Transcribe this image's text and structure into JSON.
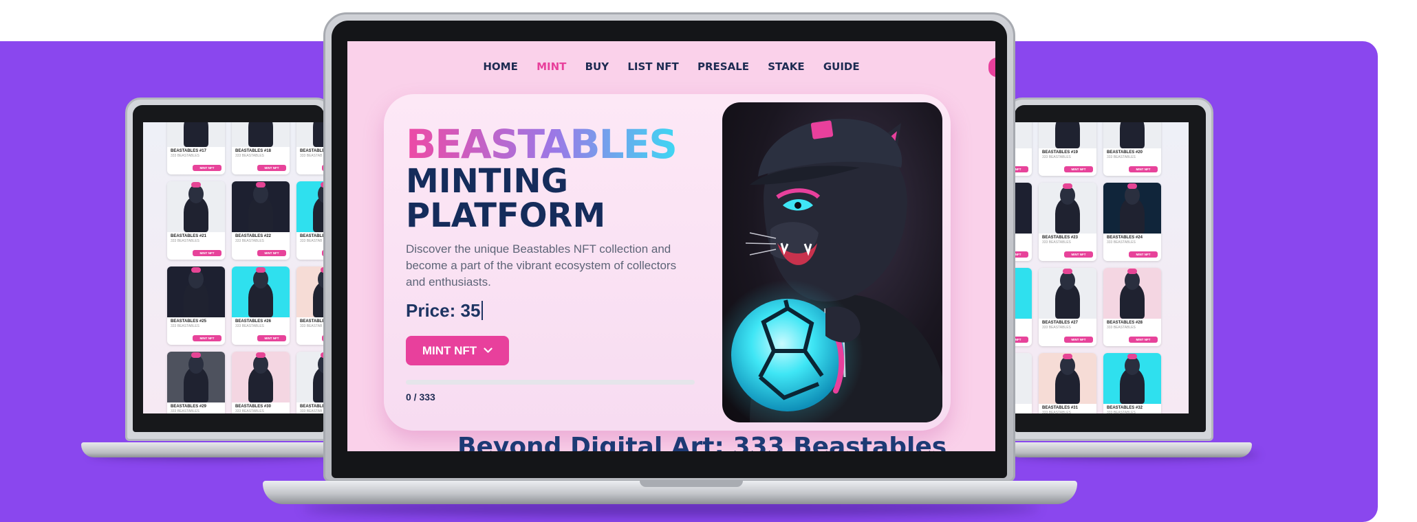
{
  "nav": {
    "items": [
      {
        "label": "HOME",
        "active": false
      },
      {
        "label": "MINT",
        "active": true
      },
      {
        "label": "BUY",
        "active": false
      },
      {
        "label": "LIST NFT",
        "active": false
      },
      {
        "label": "PRESALE",
        "active": false
      },
      {
        "label": "STAKE",
        "active": false
      },
      {
        "label": "GUIDE",
        "active": false
      }
    ]
  },
  "hero": {
    "brand": "BEASTABLES",
    "headline_line1": "MINTING",
    "headline_line2": "PLATFORM",
    "description": "Discover the unique Beastables NFT collection and become a part of the vibrant ecosystem of collectors and enthusiasts.",
    "price": "Price: 35",
    "mint_button": "MINT NFT",
    "mint_button_icon": "chevron-down-icon",
    "progress": {
      "minted": 0,
      "total": 333,
      "label": "0 / 333"
    }
  },
  "section_heading": "Beyond Digital Art: 333 Beastables",
  "colors": {
    "purple_background": "#8a47ee",
    "accent_pink": "#e8409c",
    "navy_text": "#152c5b",
    "screen_pink": "#fad1ea"
  },
  "left_laptop": {
    "cards": [
      {
        "title": "BEASTABLES #17",
        "sub": "333 BEASTABLES",
        "button": "MINT NFT",
        "tone": "t-white"
      },
      {
        "title": "BEASTABLES #18",
        "sub": "333 BEASTABLES",
        "button": "MINT NFT",
        "tone": "t-white"
      },
      {
        "title": "BEASTABLES",
        "sub": "333 BEASTAB",
        "button": "MINT NFT",
        "tone": "t-white"
      },
      {
        "title": "BEASTABLES #21",
        "sub": "333 BEASTABLES",
        "button": "MINT NFT",
        "tone": "t-white"
      },
      {
        "title": "BEASTABLES #22",
        "sub": "333 BEASTABLES",
        "button": "MINT NFT",
        "tone": "t-dark"
      },
      {
        "title": "BEASTABLES",
        "sub": "333 BEASTAB",
        "button": "MINT NFT",
        "tone": "t-cyan"
      },
      {
        "title": "BEASTABLES #25",
        "sub": "333 BEASTABLES",
        "button": "MINT NFT",
        "tone": "t-dark"
      },
      {
        "title": "BEASTABLES #26",
        "sub": "333 BEASTABLES",
        "button": "MINT NFT",
        "tone": "t-cyan"
      },
      {
        "title": "BEASTABLES",
        "sub": "333 BEASTAB",
        "button": "MINT NFT",
        "tone": "t-peach"
      },
      {
        "title": "BEASTABLES #29",
        "sub": "333 BEASTABLES",
        "button": "MINT NFT",
        "tone": "t-grey"
      },
      {
        "title": "BEASTABLES #30",
        "sub": "333 BEASTABLES",
        "button": "MINT NFT",
        "tone": "t-pink"
      },
      {
        "title": "BEASTABLES",
        "sub": "333 BEASTAB",
        "button": "MINT NFT",
        "tone": "t-white"
      }
    ]
  },
  "right_laptop": {
    "cards": [
      {
        "title": "S #18",
        "sub": "333 BEASTABLES",
        "button": "MINT NFT",
        "tone": "t-white"
      },
      {
        "title": "BEASTABLES #19",
        "sub": "333 BEASTABLES",
        "button": "MINT NFT",
        "tone": "t-white"
      },
      {
        "title": "BEASTABLES #20",
        "sub": "333 BEASTABLES",
        "button": "MINT NFT",
        "tone": "t-white"
      },
      {
        "title": "S #22",
        "sub": "333 BEASTABLES",
        "button": "MINT NFT",
        "tone": "t-dark"
      },
      {
        "title": "BEASTABLES #23",
        "sub": "333 BEASTABLES",
        "button": "MINT NFT",
        "tone": "t-white"
      },
      {
        "title": "BEASTABLES #24",
        "sub": "333 BEASTABLES",
        "button": "MINT NFT",
        "tone": "t-navy"
      },
      {
        "title": "S #26",
        "sub": "333 BEASTABLES",
        "button": "MINT NFT",
        "tone": "t-cyan"
      },
      {
        "title": "BEASTABLES #27",
        "sub": "333 BEASTABLES",
        "button": "MINT NFT",
        "tone": "t-white"
      },
      {
        "title": "BEASTABLES #28",
        "sub": "333 BEASTABLES",
        "button": "MINT NFT",
        "tone": "t-pink"
      },
      {
        "title": "S #30",
        "sub": "333 BEASTABLES",
        "button": "MINT NFT",
        "tone": "t-white"
      },
      {
        "title": "BEASTABLES #31",
        "sub": "333 BEASTABLES",
        "button": "MINT NFT",
        "tone": "t-peach"
      },
      {
        "title": "BEASTABLES #32",
        "sub": "333 BEASTABLES",
        "button": "MINT NFT",
        "tone": "t-cyan"
      }
    ]
  }
}
